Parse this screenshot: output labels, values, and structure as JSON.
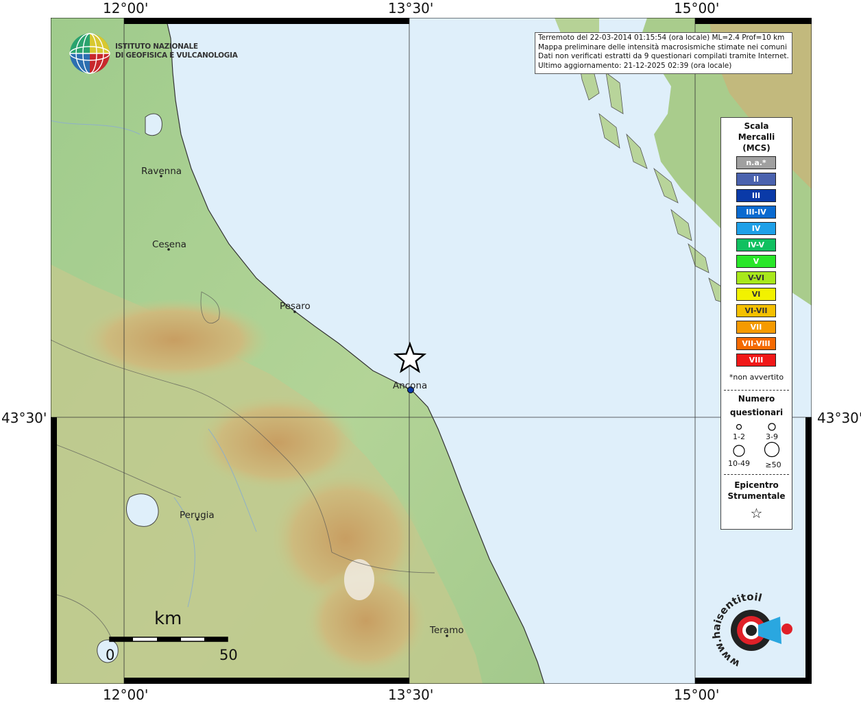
{
  "grid_labels": {
    "lon_top": [
      "12°00'",
      "13°30'",
      "15°00'"
    ],
    "lon_bottom": [
      "12°00'",
      "13°30'",
      "15°00'"
    ],
    "lat_left": "43°30'",
    "lat_right": "43°30'"
  },
  "logo": {
    "line1": "ISTITUTO NAZIONALE",
    "line2": "DI GEOFISICA E VULCANOLOGIA"
  },
  "info": {
    "line1": "Terremoto del 22-03-2014 01:15:54 (ora locale) ML=2.4 Prof=10 km",
    "line2": "Mappa preliminare delle intensità macrosismiche stimate nei comuni",
    "line3": "Dati non verificati estratti da 9 questionari compilati tramite Internet.",
    "line4": "Ultimo aggiornamento: 21-12-2025 02:39 (ora locale)"
  },
  "cities": [
    {
      "name": "Ravenna"
    },
    {
      "name": "Cesena"
    },
    {
      "name": "Pesaro"
    },
    {
      "name": "Ancona"
    },
    {
      "name": "Perugia"
    },
    {
      "name": "Teramo"
    }
  ],
  "legend": {
    "title_line1": "Scala",
    "title_line2": "Mercalli",
    "title_line3": "(MCS)",
    "scale": [
      {
        "label": "n.a.*",
        "color": "#a0a0a0"
      },
      {
        "label": "II",
        "color": "#4a62ae"
      },
      {
        "label": "III",
        "color": "#0a3aa8"
      },
      {
        "label": "III-IV",
        "color": "#0a6ad0"
      },
      {
        "label": "IV",
        "color": "#1ea0e8"
      },
      {
        "label": "IV-V",
        "color": "#10c060"
      },
      {
        "label": "V",
        "color": "#28e628"
      },
      {
        "label": "V-VI",
        "color": "#a8e81c"
      },
      {
        "label": "VI",
        "color": "#f2f200"
      },
      {
        "label": "VI-VII",
        "color": "#f5c000"
      },
      {
        "label": "VII",
        "color": "#f59a00"
      },
      {
        "label": "VII-VIII",
        "color": "#f56a00"
      },
      {
        "label": "VIII",
        "color": "#f01818"
      }
    ],
    "na_note": "*non avvertito",
    "count_title_line1": "Numero",
    "count_title_line2": "questionari",
    "counts": [
      "1-2",
      "3-9",
      "10-49",
      "≥50"
    ],
    "epicenter_line1": "Epicentro",
    "epicenter_line2": "Strumentale",
    "epicenter_symbol": "☆"
  },
  "scale_bar": {
    "unit": "km",
    "min": "0",
    "max": "50"
  },
  "haisentito": {
    "text": "www.haisentitoilterremoto.it"
  },
  "colors": {
    "sea": "#dfeffa",
    "plain": "#a8cf8f",
    "hills": "#c9c78e",
    "mountains": "#c6a06a",
    "epicenter_star": "#ffffff",
    "station_dot": "#0a3aa8"
  }
}
